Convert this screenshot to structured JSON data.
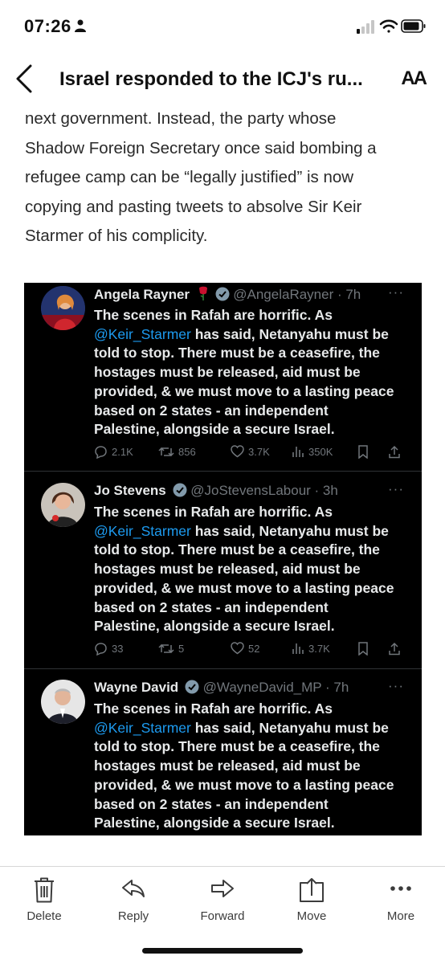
{
  "status_bar": {
    "time": "07:26"
  },
  "nav": {
    "title": "Israel responded to the ICJ's ru...",
    "text_size_label": "AA"
  },
  "article": {
    "lines": [
      "next government. Instead, the party whose",
      "Shadow Foreign Secretary once said bombing a",
      "refugee camp can be “legally justified” is now",
      "copying and pasting tweets to absolve Sir Keir",
      "Starmer of his complicity."
    ]
  },
  "tweet_text": {
    "line1": "The scenes in Rafah are horrific. As",
    "mention": "@Keir_Starmer",
    "line2_rest": " has said, Netanyahu must be",
    "line3": "told to stop. There must be a ceasefire, the",
    "line4": "hostages must be released, aid must be",
    "line5": "provided, & we must move to a lasting peace",
    "line6": "based on 2 states - an independent",
    "line7": "Palestine, alongside a secure Israel."
  },
  "tweets": [
    {
      "name": "Angela Rayner",
      "handle": "@AngelaRayner · 7h",
      "replies": "2.1K",
      "reposts": "856",
      "likes": "3.7K",
      "views": "350K"
    },
    {
      "name": "Jo Stevens",
      "handle": "@JoStevensLabour · 3h",
      "replies": "33",
      "reposts": "5",
      "likes": "52",
      "views": "3.7K"
    },
    {
      "name": "Wayne David",
      "handle": "@WayneDavid_MP · 7h"
    }
  ],
  "toolbar": {
    "delete": "Delete",
    "reply": "Reply",
    "forward": "Forward",
    "move": "Move",
    "more": "More"
  },
  "colors": {
    "tweet_bg": "#000000",
    "mention": "#1d9bf0",
    "verified": "#829aab",
    "rose": "#c8102e"
  },
  "icons": [
    "person-icon",
    "signal-icon",
    "wifi-icon",
    "battery-icon",
    "back-chevron-icon",
    "text-size-icon",
    "rose-emoji-icon",
    "verified-badge-icon",
    "reply-icon",
    "repost-icon",
    "like-icon",
    "views-icon",
    "bookmark-icon",
    "share-icon",
    "trash-icon",
    "reply-arrow-icon",
    "forward-arrow-icon",
    "move-icon",
    "more-dots-icon"
  ]
}
